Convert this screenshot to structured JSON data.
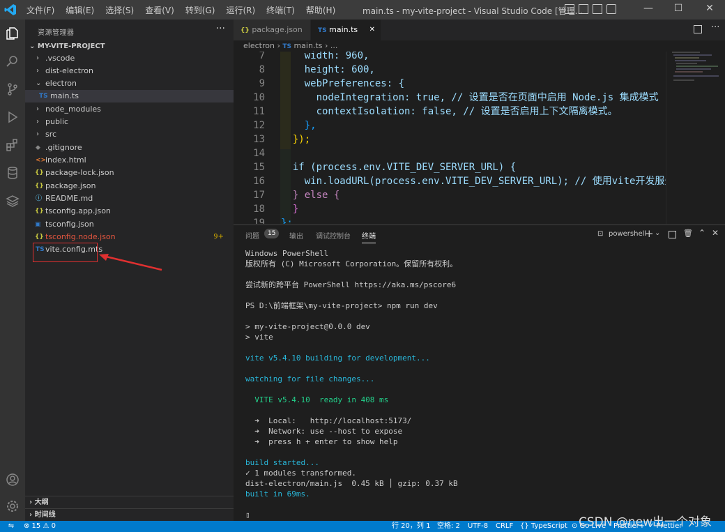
{
  "titlebar": {
    "menus": [
      "文件(F)",
      "编辑(E)",
      "选择(S)",
      "查看(V)",
      "转到(G)",
      "运行(R)",
      "终端(T)",
      "帮助(H)"
    ],
    "title": "main.ts - my-vite-project - Visual Studio Code [管理..."
  },
  "sidebar": {
    "title": "资源管理器",
    "more": "···",
    "project": "MY-VITE-PROJECT",
    "items": [
      {
        "label": ".vscode"
      },
      {
        "label": "dist-electron"
      },
      {
        "label": "electron"
      },
      {
        "label": "main.ts",
        "icon": "TS"
      },
      {
        "label": "node_modules"
      },
      {
        "label": "public"
      },
      {
        "label": "src"
      },
      {
        "label": ".gitignore"
      },
      {
        "label": "index.html"
      },
      {
        "label": "package-lock.json",
        "icon": "{}"
      },
      {
        "label": "package.json",
        "icon": "{}"
      },
      {
        "label": "README.md"
      },
      {
        "label": "tsconfig.app.json",
        "icon": "{}"
      },
      {
        "label": "tsconfig.json"
      },
      {
        "label": "tsconfig.node.json",
        "icon": "{}",
        "badge": "9+"
      },
      {
        "label": "vite.config.mts",
        "icon": "TS"
      }
    ],
    "outline": "大纲",
    "timeline": "时间线"
  },
  "tabs": [
    {
      "label": "package.json",
      "icon": "{}"
    },
    {
      "label": "main.ts",
      "icon": "TS",
      "close": "✕"
    }
  ],
  "breadcrumb": {
    "folder": "electron",
    "sep": "›",
    "file": "main.ts",
    "icon": "TS",
    "tail": "..."
  },
  "editor": {
    "lines": [
      {
        "n": "7",
        "code": "    width: 960,"
      },
      {
        "n": "8",
        "code": "    height: 600,"
      },
      {
        "n": "9",
        "code": "    webPreferences: {"
      },
      {
        "n": "10",
        "code": "      nodeIntegration: true, // 设置是否在页面中启用 Node.js 集成模式"
      },
      {
        "n": "11",
        "code": "      contextIsolation: false, // 设置是否启用上下文隔离模式。"
      },
      {
        "n": "12",
        "code": "    },"
      },
      {
        "n": "13",
        "code": "  });"
      },
      {
        "n": "14",
        "code": ""
      },
      {
        "n": "15",
        "code": "  if (process.env.VITE_DEV_SERVER_URL) {"
      },
      {
        "n": "16",
        "code": "    win.loadURL(process.env.VITE_DEV_SERVER_URL); // 使用vite开发服务"
      },
      {
        "n": "17",
        "code": "  } else {"
      },
      {
        "n": "18",
        "code": "  }"
      },
      {
        "n": "19",
        "code": "};"
      }
    ]
  },
  "panel": {
    "tabs": [
      "问题",
      "输出",
      "调试控制台",
      "终端"
    ],
    "problems_count": "15",
    "shell": "powershell",
    "terminal": [
      "Windows PowerShell",
      "版权所有 (C) Microsoft Corporation。保留所有权利。",
      "",
      "尝试新的跨平台 PowerShell https://aka.ms/pscore6",
      "",
      "PS D:\\前端框架\\my-vite-project> npm run dev",
      "",
      "> my-vite-project@0.0.0 dev",
      "> vite",
      "",
      "vite v5.4.10 building for development...",
      "",
      "watching for file changes...",
      "",
      "  VITE v5.4.10  ready in 408 ms",
      "",
      "  ➜  Local:   http://localhost:5173/",
      "  ➜  Network: use --host to expose",
      "  ➜  press h + enter to show help",
      "",
      "build started...",
      "✓ 1 modules transformed.",
      "dist-electron/main.js  0.45 kB │ gzip: 0.37 kB",
      "built in 69ms.",
      "",
      "▯"
    ]
  },
  "statusbar": {
    "errors": "⊗ 15 ⚠ 0",
    "position": "行 20，列 1",
    "spaces": "空格: 2",
    "encoding": "UTF-8",
    "eol": "CRLF",
    "language": "{} TypeScript",
    "golive": "⊙ Go Live",
    "prettier_plus": "Prettier+",
    "prettier": "✓ Prettier"
  },
  "watermark": "CSDN @new出一个对象"
}
